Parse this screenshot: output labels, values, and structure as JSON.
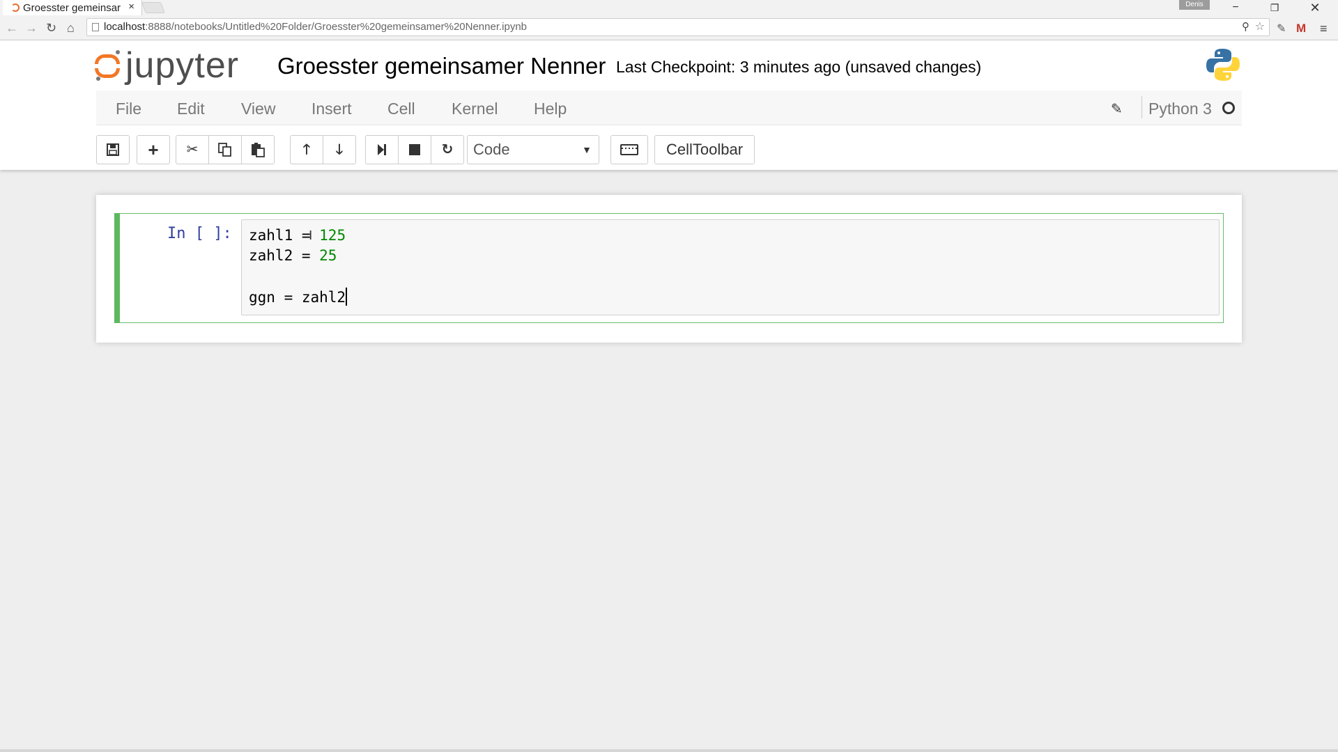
{
  "browser": {
    "tab_title": "Groesster gemeinsar",
    "tab_close": "×",
    "user_badge": "Denis",
    "window_min": "−",
    "window_max": "❐",
    "window_close": "✕",
    "url_host": "localhost",
    "url_rest": ":8888/notebooks/Untitled%20Folder/Groesster%20gemeinsamer%20Nenner.ipynb"
  },
  "header": {
    "logo_text": "jupyter",
    "notebook_name": "Groesster gemeinsamer Nenner",
    "checkpoint": "Last Checkpoint: 3 minutes ago (unsaved changes)"
  },
  "menubar": {
    "items": [
      "File",
      "Edit",
      "View",
      "Insert",
      "Cell",
      "Kernel",
      "Help"
    ],
    "kernel_name": "Python 3"
  },
  "toolbar": {
    "cell_type": "Code",
    "celltoolbar_label": "CellToolbar",
    "icons": [
      "save-icon",
      "plus-icon",
      "cut-icon",
      "copy-icon",
      "paste-icon",
      "arrow-up-icon",
      "arrow-down-icon",
      "step-forward-icon",
      "stop-icon",
      "refresh-icon",
      "keyboard-icon"
    ]
  },
  "cell": {
    "prompt": "In [ ]:",
    "lines": [
      {
        "code": "zahl1 = ",
        "number": "125"
      },
      {
        "code": "zahl2 = ",
        "number": "25"
      },
      {
        "code": "",
        "number": ""
      },
      {
        "code": "ggn = zahl2",
        "number": ""
      }
    ]
  },
  "colors": {
    "jupyter_orange": "#f37626",
    "selected_cell_green": "#5cb85c",
    "prompt_blue": "#303f9f",
    "number_green": "#008800"
  }
}
